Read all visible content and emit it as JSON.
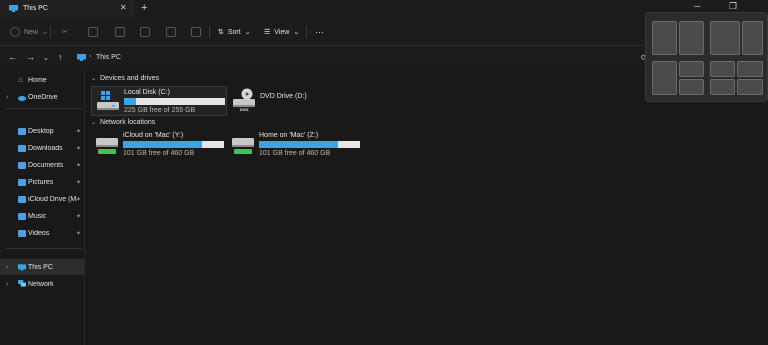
{
  "window": {
    "tab_title": "This PC",
    "tab_close": "✕",
    "new_tab": "+"
  },
  "toolbar": {
    "new_label": "New",
    "sort_label": "Sort",
    "view_label": "View",
    "more_label": "···"
  },
  "address": {
    "crumb": "This PC",
    "crumb_sep": "›"
  },
  "nav": {
    "items": [
      {
        "label": "Home"
      },
      {
        "label": "OneDrive"
      },
      {
        "label": "Desktop"
      },
      {
        "label": "Downloads"
      },
      {
        "label": "Documents"
      },
      {
        "label": "Pictures"
      },
      {
        "label": "iCloud Drive (Mac"
      },
      {
        "label": "Music"
      },
      {
        "label": "Videos"
      },
      {
        "label": "This PC"
      },
      {
        "label": "Network"
      }
    ],
    "expander": "›",
    "pin": "📌"
  },
  "content": {
    "devices_header": "Devices and drives",
    "network_header": "Network locations",
    "chev": "⌄",
    "drives": [
      {
        "name": "Local Disk (C:)",
        "free": "225 GB free of 255 GB",
        "used_fraction": 0.12
      },
      {
        "name": "DVD Drive (D:)",
        "free": ""
      },
      {
        "name": "iCloud on 'Mac' (Y:)",
        "free": "101 GB free of 460 GB",
        "used_fraction": 0.78
      },
      {
        "name": "Home on 'Mac' (Z:)",
        "free": "101 GB free of 460 GB",
        "used_fraction": 0.78
      }
    ],
    "dvd_badge": "DVD"
  },
  "colors": {
    "accent": "#3aa4e8",
    "folder": "#4ea0e6",
    "background": "#191919"
  }
}
